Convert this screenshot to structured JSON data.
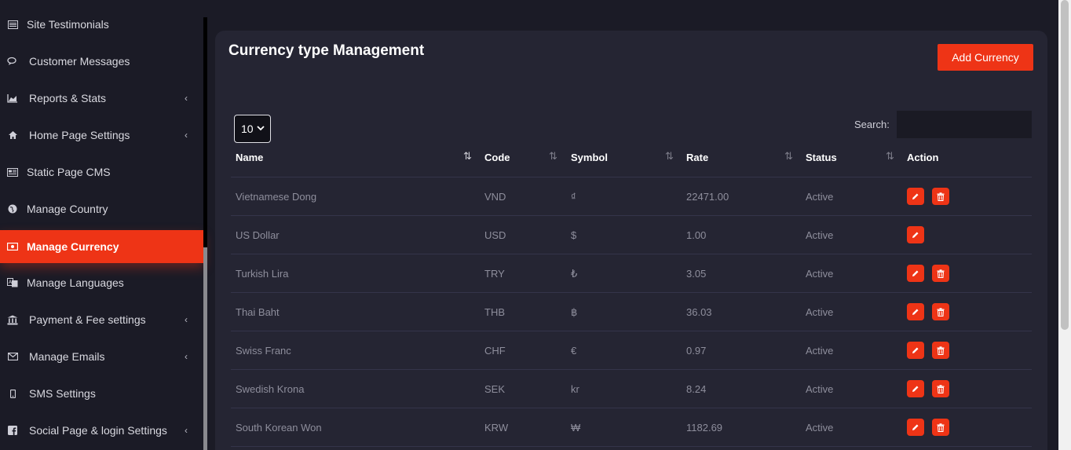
{
  "sidebar": {
    "items": [
      {
        "label": "Site Testimonials",
        "icon": "list-icon",
        "chevron": false
      },
      {
        "label": "Customer Messages",
        "icon": "chat-icon",
        "chevron": false
      },
      {
        "label": "Reports & Stats",
        "icon": "area-chart-icon",
        "chevron": true
      },
      {
        "label": "Home Page Settings",
        "icon": "home-icon",
        "chevron": true
      },
      {
        "label": "Static Page CMS",
        "icon": "newspaper-icon",
        "chevron": false
      },
      {
        "label": "Manage Country",
        "icon": "globe-icon",
        "chevron": false
      },
      {
        "label": "Manage Currency",
        "icon": "money-icon",
        "chevron": false,
        "active": true
      },
      {
        "label": "Manage Languages",
        "icon": "language-icon",
        "chevron": false
      },
      {
        "label": "Payment & Fee settings",
        "icon": "bank-icon",
        "chevron": true
      },
      {
        "label": "Manage Emails",
        "icon": "envelope-icon",
        "chevron": true
      },
      {
        "label": "SMS Settings",
        "icon": "mobile-icon",
        "chevron": false
      },
      {
        "label": "Social Page & login Settings",
        "icon": "facebook-icon",
        "chevron": true
      }
    ],
    "chevron_glyph": "‹"
  },
  "page": {
    "title": "Currency type Management",
    "add_button": "Add Currency",
    "page_length": "10",
    "search_label": "Search:"
  },
  "table": {
    "columns": [
      "Name",
      "Code",
      "Symbol",
      "Rate",
      "Status",
      "Action"
    ],
    "rows": [
      {
        "name": "Vietnamese Dong",
        "code": "VND",
        "symbol": "₫",
        "rate": "22471.00",
        "status": "Active",
        "delete": true
      },
      {
        "name": "US Dollar",
        "code": "USD",
        "symbol": "$",
        "rate": "1.00",
        "status": "Active",
        "delete": false
      },
      {
        "name": "Turkish Lira",
        "code": "TRY",
        "symbol": "₺",
        "rate": "3.05",
        "status": "Active",
        "delete": true
      },
      {
        "name": "Thai Baht",
        "code": "THB",
        "symbol": "฿",
        "rate": "36.03",
        "status": "Active",
        "delete": true
      },
      {
        "name": "Swiss Franc",
        "code": "CHF",
        "symbol": "€",
        "rate": "0.97",
        "status": "Active",
        "delete": true
      },
      {
        "name": "Swedish Krona",
        "code": "SEK",
        "symbol": "kr",
        "rate": "8.24",
        "status": "Active",
        "delete": true
      },
      {
        "name": "South Korean Won",
        "code": "KRW",
        "symbol": "₩",
        "rate": "1182.69",
        "status": "Active",
        "delete": true
      }
    ]
  },
  "colors": {
    "accent": "#ee3416",
    "background": "#1b1b26",
    "card": "#252533"
  }
}
